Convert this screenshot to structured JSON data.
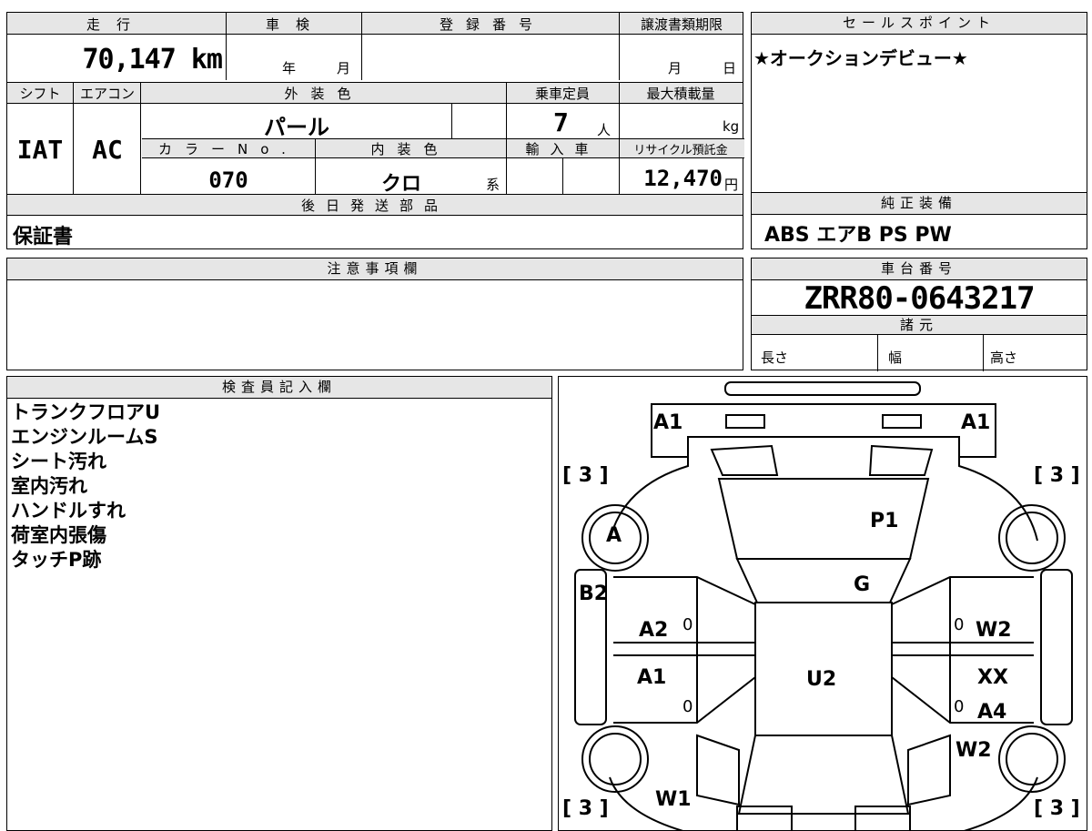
{
  "top_left": {
    "mileage_label": "走行",
    "mileage_value": "70,147 km",
    "inspection_label": "車検",
    "inspection_year_unit": "年",
    "inspection_month_unit": "月",
    "registration_label": "登録番号",
    "transfer_deadline_label": "譲渡書類期限",
    "transfer_month_unit": "月",
    "transfer_day_unit": "日",
    "shift_label": "シフト",
    "shift_value": "IAT",
    "ac_label": "エアコン",
    "ac_value": "AC",
    "exterior_color_label": "外装色",
    "exterior_color_value": "パール",
    "capacity_label": "乗車定員",
    "capacity_value": "7",
    "capacity_unit": "人",
    "max_load_label": "最大積載量",
    "max_load_unit": "kg",
    "color_no_label": "カラーNo.",
    "color_no_value": "070",
    "interior_color_label": "内装色",
    "interior_color_value": "クロ",
    "interior_color_suffix": "系",
    "import_label": "輸入車",
    "recycle_label": "リサイクル預託金",
    "recycle_value": "12,470",
    "recycle_unit": "円",
    "later_parts_label": "後日発送部品",
    "later_parts_value": "保証書"
  },
  "sales_point": {
    "label": "セールスポイント",
    "value": "★オークションデビュー★"
  },
  "equipment": {
    "label": "純正装備",
    "value": "ABS エアB PS PW"
  },
  "notes": {
    "label": "注意事項欄"
  },
  "chassis": {
    "label": "車台番号",
    "value": "ZRR80-0643217",
    "specs_label": "諸元",
    "length_label": "長さ",
    "width_label": "幅",
    "height_label": "高さ"
  },
  "inspector": {
    "label": "検査員記入欄",
    "lines": [
      "トランクフロアU",
      "エンジンルームS",
      "シート汚れ",
      "室内汚れ",
      "ハンドルすれ",
      "荷室内張傷",
      "タッチP跡"
    ]
  },
  "diagram": {
    "marks": {
      "a1_left": "A1",
      "a1_right": "A1",
      "tire_tl": "[ 3 ]",
      "tire_tr": "[ 3 ]",
      "tire_bl": "[ 3 ]",
      "tire_br": "[ 3 ]",
      "p1": "P1",
      "a_wheel": "A",
      "b2": "B2",
      "g": "G",
      "a2": "A2",
      "w2_right": "W2",
      "a1_mid": "A1",
      "u2": "U2",
      "xx": "XX",
      "a4": "A4",
      "w2_lower": "W2",
      "w1": "W1",
      "zero1": "0",
      "zero2": "0",
      "zero3": "0",
      "zero4": "0"
    }
  }
}
